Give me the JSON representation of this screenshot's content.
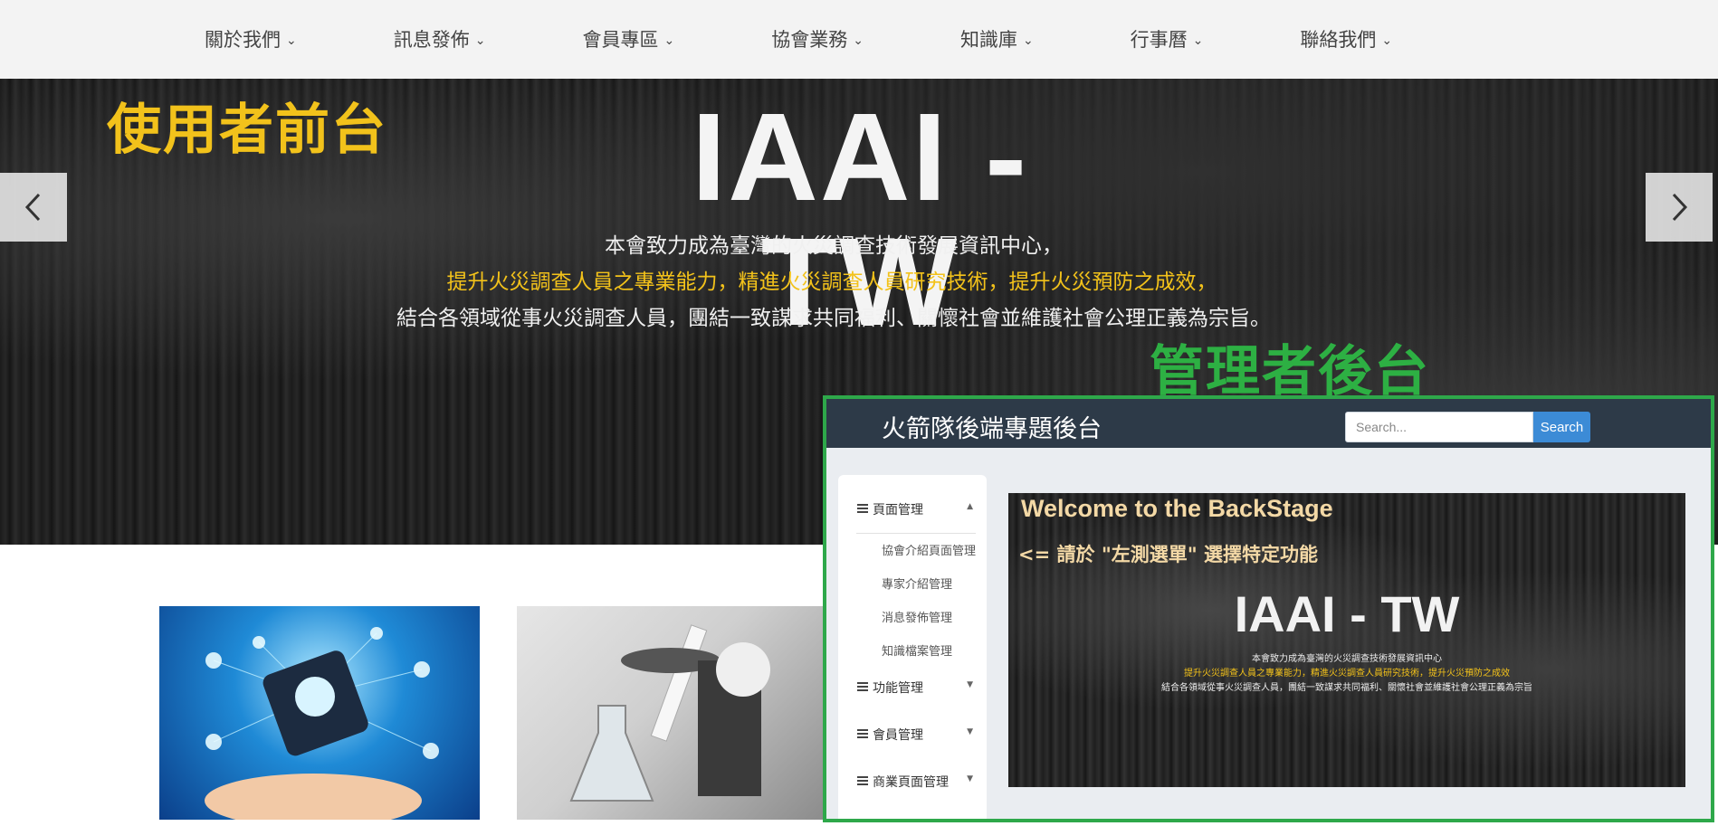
{
  "nav": {
    "items": [
      "關於我們",
      "訊息發佈",
      "會員專區",
      "協會業務",
      "知識庫",
      "行事曆",
      "聯絡我們"
    ]
  },
  "hero": {
    "title": "IAAI - TW",
    "line1": "本會致力成為臺灣的火災調查技術發展資訊中心，",
    "line2": "提升火災調查人員之專業能力，精進火災調查人員研究技術，提升火災預防之成效，",
    "line3": "結合各領域從事火災調查人員，團結一致謀求共同福利、關懷社會並維護社會公理正義為宗旨。"
  },
  "labels": {
    "front": "使用者前台",
    "back": "管理者後台"
  },
  "backstage": {
    "title": "火箭隊後端專題後台",
    "search_placeholder": "Search...",
    "search_button": "Search",
    "sidebar": {
      "groups": [
        "頁面管理",
        "功能管理",
        "會員管理",
        "商業頁面管理"
      ],
      "subitems": [
        "協會介紹頁面管理",
        "專家介紹管理",
        "消息發佈管理",
        "知識檔案管理"
      ]
    },
    "welcome": {
      "heading": "Welcome to the BackStage",
      "hint": "<= 請於 \"左測選單\" 選擇特定功能",
      "title": "IAAI - TW",
      "line1": "本會致力成為臺灣的火災調查技術發展資訊中心",
      "line2": "提升火災調查人員之專業能力，精進火災調查人員研究技術，提升火災預防之成效",
      "line3": "結合各領域從事火災調查人員，團結一致謀求共同福利、關懷社會並維護社會公理正義為宗旨"
    }
  },
  "colors": {
    "front_label": "#f2c21b",
    "back_label": "#2db043",
    "inset_border": "#2ea84a",
    "search_button": "#3c8bd6"
  },
  "icons": [
    "chevron-down-icon",
    "chevron-left-icon",
    "chevron-right-icon",
    "list-icon",
    "caret-up-icon",
    "caret-down-icon"
  ]
}
